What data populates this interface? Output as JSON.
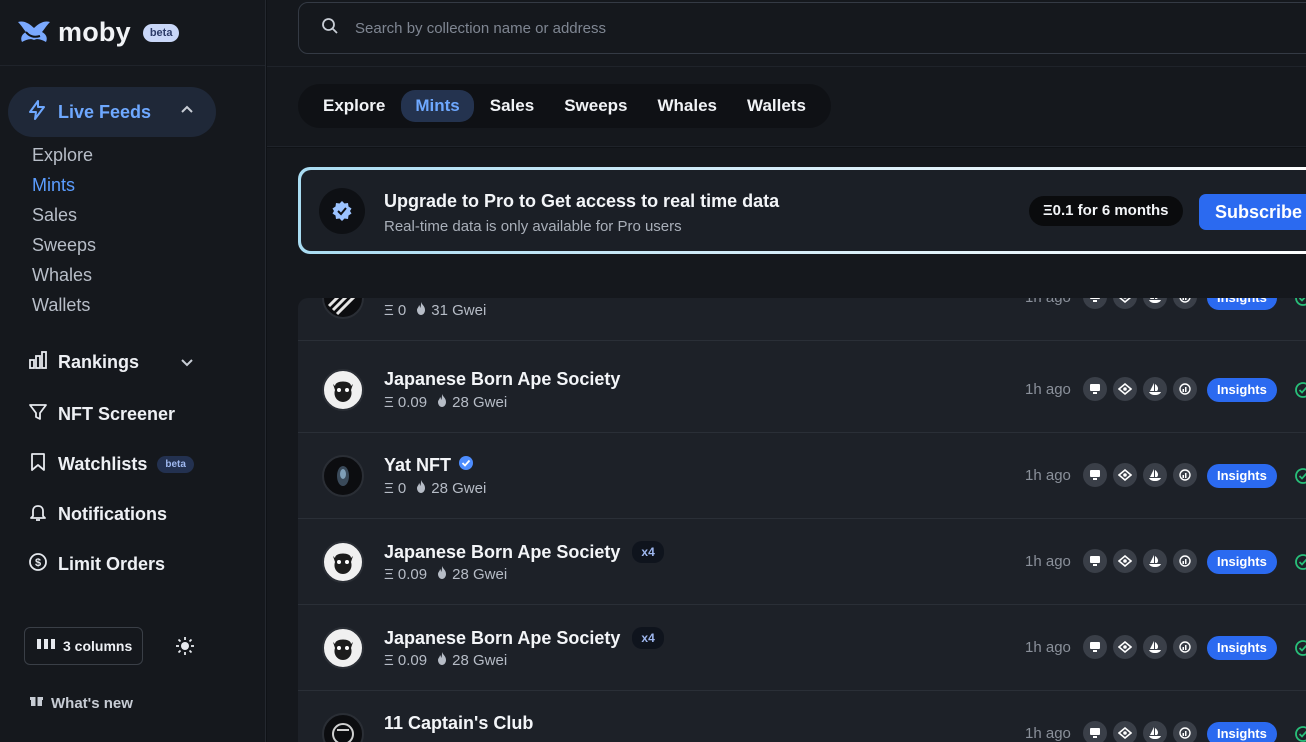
{
  "brand": {
    "name": "moby",
    "badge": "beta"
  },
  "search": {
    "placeholder": "Search by collection name or address"
  },
  "sidebar": {
    "live_feeds": "Live Feeds",
    "sub_items": [
      "Explore",
      "Mints",
      "Sales",
      "Sweeps",
      "Whales",
      "Wallets"
    ],
    "active_sub": "Mints",
    "rankings": "Rankings",
    "nft_screener": "NFT Screener",
    "watchlists": "Watchlists",
    "watchlists_badge": "beta",
    "notifications": "Notifications",
    "limit_orders": "Limit Orders",
    "columns_button": "3 columns",
    "whats_new": "What's new"
  },
  "tabs": [
    "Explore",
    "Mints",
    "Sales",
    "Sweeps",
    "Whales",
    "Wallets"
  ],
  "active_tab": "Mints",
  "upgrade": {
    "title": "Upgrade to Pro to Get access to real time data",
    "subtitle": "Real-time data is only available for Pro users",
    "price": "Ξ0.1 for 6 months",
    "subscribe": "Subscribe"
  },
  "feed": [
    {
      "name": "",
      "price": "Ξ 0",
      "gas": "31 Gwei",
      "time": "1h ago",
      "insights": "Insights",
      "tag": "",
      "verified": false,
      "avatar": "stripes"
    },
    {
      "name": "Japanese Born Ape Society",
      "price": "Ξ 0.09",
      "gas": "28 Gwei",
      "time": "1h ago",
      "insights": "Insights",
      "tag": "",
      "verified": false,
      "avatar": "ape"
    },
    {
      "name": "Yat NFT",
      "price": "Ξ 0",
      "gas": "28 Gwei",
      "time": "1h ago",
      "insights": "Insights",
      "tag": "",
      "verified": true,
      "avatar": "yat"
    },
    {
      "name": "Japanese Born Ape Society",
      "price": "Ξ 0.09",
      "gas": "28 Gwei",
      "time": "1h ago",
      "insights": "Insights",
      "tag": "x4",
      "verified": false,
      "avatar": "ape"
    },
    {
      "name": "Japanese Born Ape Society",
      "price": "Ξ 0.09",
      "gas": "28 Gwei",
      "time": "1h ago",
      "insights": "Insights",
      "tag": "x4",
      "verified": false,
      "avatar": "ape"
    },
    {
      "name": "11 Captain's Club",
      "price": "",
      "gas": "",
      "time": "1h ago",
      "insights": "Insights",
      "tag": "",
      "verified": false,
      "avatar": "captain"
    }
  ],
  "colors": {
    "accent": "#2b6af0",
    "active_text": "#6ea8ff",
    "background": "#15181d"
  }
}
